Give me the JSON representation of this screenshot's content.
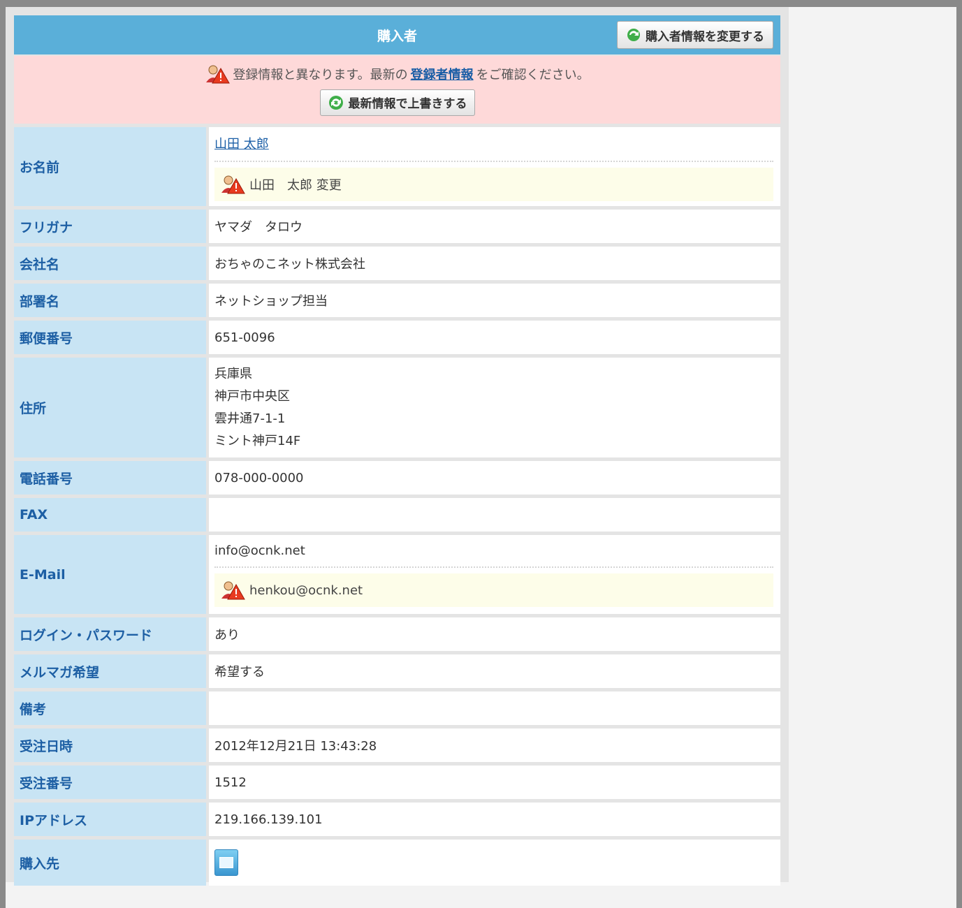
{
  "header": {
    "title": "購入者",
    "change_button": "購入者情報を変更する"
  },
  "notice": {
    "text_before": "登録情報と異なります。最新の",
    "link": "登録者情報",
    "text_after": "をご確認ください。",
    "overwrite_button": "最新情報で上書きする"
  },
  "rows": {
    "name": {
      "label": "お名前",
      "value": "山田 太郎",
      "changed": "山田　太郎 変更"
    },
    "furigana": {
      "label": "フリガナ",
      "value": "ヤマダ　タロウ"
    },
    "company": {
      "label": "会社名",
      "value": "おちゃのこネット株式会社"
    },
    "department": {
      "label": "部署名",
      "value": "ネットショップ担当"
    },
    "zip": {
      "label": "郵便番号",
      "value": "651-0096"
    },
    "address": {
      "label": "住所",
      "lines": [
        "兵庫県",
        "神戸市中央区",
        "雲井通7-1-1",
        "ミント神戸14F"
      ]
    },
    "tel": {
      "label": "電話番号",
      "value": "078-000-0000"
    },
    "fax": {
      "label": "FAX",
      "value": ""
    },
    "email": {
      "label": "E-Mail",
      "value": "info@ocnk.net",
      "changed": "henkou@ocnk.net"
    },
    "password": {
      "label": "ログイン・パスワード",
      "value": "あり"
    },
    "newsletter": {
      "label": "メルマガ希望",
      "value": "希望する"
    },
    "remarks": {
      "label": "備考",
      "value": ""
    },
    "order_date": {
      "label": "受注日時",
      "value": "2012年12月21日 13:43:28"
    },
    "order_number": {
      "label": "受注番号",
      "value": "1512"
    },
    "ip": {
      "label": "IPアドレス",
      "value": "219.166.139.101"
    },
    "source": {
      "label": "購入先",
      "icon": "pc-icon"
    }
  }
}
